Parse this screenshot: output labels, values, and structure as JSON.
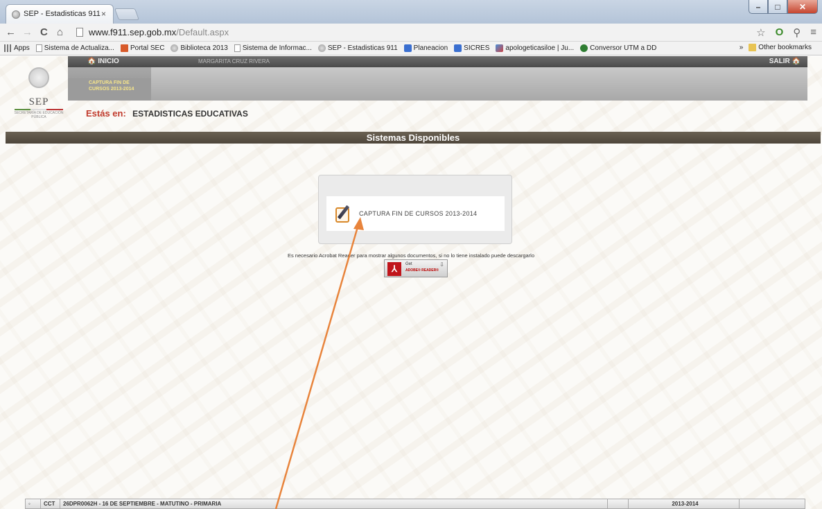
{
  "browser": {
    "tab_title": "SEP - Estadisticas 911",
    "tab_close": "×",
    "url_host": "www.f911.sep.gob.mx",
    "url_path": "/Default.aspx",
    "nav": {
      "back": "←",
      "forward": "→",
      "reload": "C",
      "home": "⌂"
    },
    "bookmarks": [
      {
        "label": "Apps",
        "icon": "apps-icon"
      },
      {
        "label": "Sistema de Actualiza...",
        "icon": "doc-icon"
      },
      {
        "label": "Portal SEC",
        "icon": "portal-icon"
      },
      {
        "label": "Biblioteca 2013",
        "icon": "globe-icon"
      },
      {
        "label": "Sistema de Informac...",
        "icon": "doc-icon"
      },
      {
        "label": "SEP - Estadisticas 911",
        "icon": "globe-icon"
      },
      {
        "label": "Planeacion",
        "icon": "blue-icon"
      },
      {
        "label": "SICRES",
        "icon": "blue-icon"
      },
      {
        "label": "apologeticasiloe | Ju...",
        "icon": "people-icon"
      },
      {
        "label": "Conversor UTM a DD",
        "icon": "green-icon"
      }
    ],
    "bookmarks_overflow": "»",
    "other_bookmarks": "Other bookmarks"
  },
  "header": {
    "logo_text": "SEP",
    "logo_sub": "SECRETARÍA DE EDUCACIÓN PÚBLICA",
    "inicio": "INICIO",
    "user": "MARGARITA CRUZ RIVERA",
    "salir": "SALIR",
    "menu_link": "CAPTURA FIN DE CURSOS 2013-2014"
  },
  "location": {
    "label": "Estás en:",
    "value": "ESTADISTICAS EDUCATIVAS"
  },
  "section_title": "Sistemas Disponibles",
  "systems": [
    {
      "label": "CAPTURA FIN DE CURSOS 2013-2014",
      "icon": "pencil-edit-icon"
    }
  ],
  "acrobat": {
    "message": "Es necesario Acrobat Reader para mostrar algunos documentos, si no lo tiene instalado puede descargarlo",
    "get": "Get",
    "reader": "ADOBE® READER®"
  },
  "statusbar": {
    "cct_label": "CCT",
    "school": "26DPR0062H - 16 DE SEPTIEMBRE - MATUTINO - PRIMARIA",
    "cycle": "2013-2014"
  },
  "annotation": {
    "arrow_color": "#e8843c"
  }
}
